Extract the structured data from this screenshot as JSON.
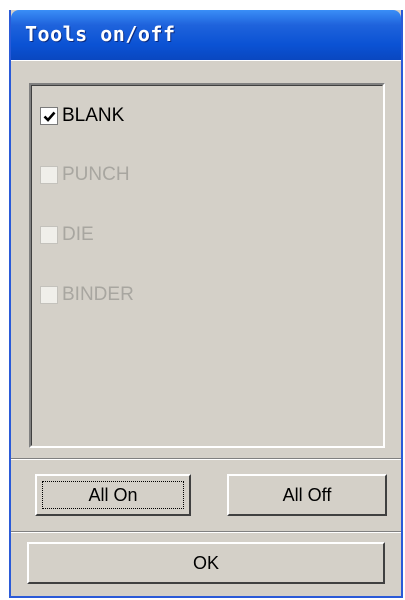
{
  "window": {
    "title": "Tools on/off"
  },
  "tools": [
    {
      "label": "BLANK",
      "checked": true,
      "enabled": true
    },
    {
      "label": "PUNCH",
      "checked": false,
      "enabled": false
    },
    {
      "label": "DIE",
      "checked": false,
      "enabled": false
    },
    {
      "label": "BINDER",
      "checked": false,
      "enabled": false
    }
  ],
  "buttons": {
    "all_on": "All On",
    "all_off": "All Off",
    "ok": "OK"
  },
  "colors": {
    "titlebar": "#0b52d4",
    "face": "#d4d0c8",
    "disabled_text": "#a8a6a0"
  }
}
